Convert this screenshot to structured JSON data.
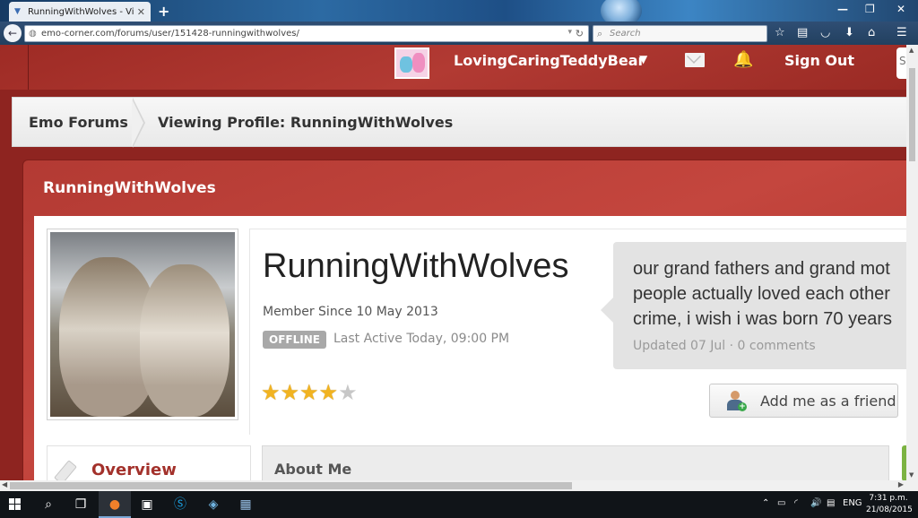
{
  "browser": {
    "tab_title": "RunningWithWolves - Vie...",
    "url": "emo-corner.com/forums/user/151428-runningwithwolves/",
    "search_placeholder": "Search"
  },
  "header": {
    "username": "LovingCaringTeddyBear",
    "sign_out": "Sign Out",
    "edge_letter": "S"
  },
  "breadcrumb": {
    "items": [
      "Emo Forums",
      "Viewing Profile: RunningWithWolves"
    ]
  },
  "profile": {
    "name_bar": "RunningWithWolves",
    "display_name": "RunningWithWolves",
    "member_since": "Member Since 10 May 2013",
    "status_badge": "OFFLINE",
    "last_active": "Last Active Today, 09:00 PM",
    "rating": 4,
    "rating_max": 5,
    "status_update": {
      "lines": [
        "our grand fathers and grand mot",
        "people actually loved each other",
        "crime, i wish i was born 70 years"
      ],
      "meta": "Updated 07 Jul · 0 comments"
    },
    "add_friend": "Add me as a friend",
    "tabs": {
      "overview": "Overview",
      "about": "About Me"
    }
  },
  "taskbar": {
    "lang": "ENG",
    "time": "7:31 p.m.",
    "date": "21/08/2015"
  },
  "colors": {
    "brand_red": "#b33a33",
    "star": "#f1b321",
    "offline_badge": "#a8a8a8"
  }
}
